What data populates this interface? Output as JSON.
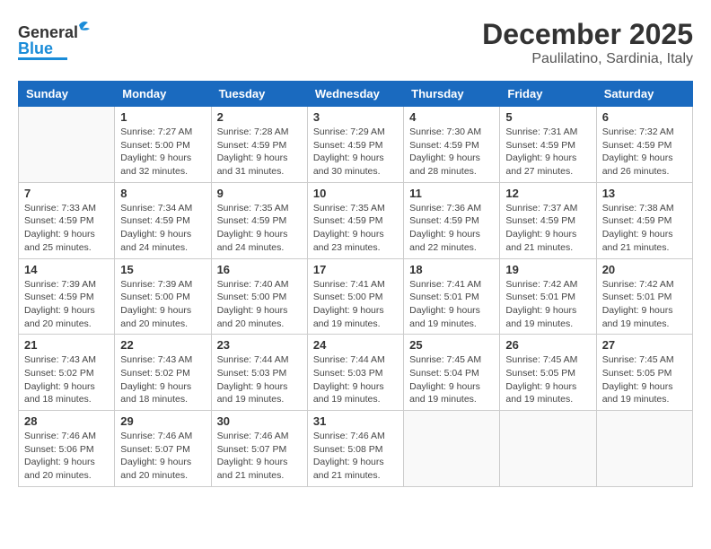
{
  "header": {
    "logo_general": "General",
    "logo_blue": "Blue",
    "month": "December 2025",
    "location": "Paulilatino, Sardinia, Italy"
  },
  "weekdays": [
    "Sunday",
    "Monday",
    "Tuesday",
    "Wednesday",
    "Thursday",
    "Friday",
    "Saturday"
  ],
  "weeks": [
    [
      {
        "day": "",
        "info": ""
      },
      {
        "day": "1",
        "info": "Sunrise: 7:27 AM\nSunset: 5:00 PM\nDaylight: 9 hours\nand 32 minutes."
      },
      {
        "day": "2",
        "info": "Sunrise: 7:28 AM\nSunset: 4:59 PM\nDaylight: 9 hours\nand 31 minutes."
      },
      {
        "day": "3",
        "info": "Sunrise: 7:29 AM\nSunset: 4:59 PM\nDaylight: 9 hours\nand 30 minutes."
      },
      {
        "day": "4",
        "info": "Sunrise: 7:30 AM\nSunset: 4:59 PM\nDaylight: 9 hours\nand 28 minutes."
      },
      {
        "day": "5",
        "info": "Sunrise: 7:31 AM\nSunset: 4:59 PM\nDaylight: 9 hours\nand 27 minutes."
      },
      {
        "day": "6",
        "info": "Sunrise: 7:32 AM\nSunset: 4:59 PM\nDaylight: 9 hours\nand 26 minutes."
      }
    ],
    [
      {
        "day": "7",
        "info": "Sunrise: 7:33 AM\nSunset: 4:59 PM\nDaylight: 9 hours\nand 25 minutes."
      },
      {
        "day": "8",
        "info": "Sunrise: 7:34 AM\nSunset: 4:59 PM\nDaylight: 9 hours\nand 24 minutes."
      },
      {
        "day": "9",
        "info": "Sunrise: 7:35 AM\nSunset: 4:59 PM\nDaylight: 9 hours\nand 24 minutes."
      },
      {
        "day": "10",
        "info": "Sunrise: 7:35 AM\nSunset: 4:59 PM\nDaylight: 9 hours\nand 23 minutes."
      },
      {
        "day": "11",
        "info": "Sunrise: 7:36 AM\nSunset: 4:59 PM\nDaylight: 9 hours\nand 22 minutes."
      },
      {
        "day": "12",
        "info": "Sunrise: 7:37 AM\nSunset: 4:59 PM\nDaylight: 9 hours\nand 21 minutes."
      },
      {
        "day": "13",
        "info": "Sunrise: 7:38 AM\nSunset: 4:59 PM\nDaylight: 9 hours\nand 21 minutes."
      }
    ],
    [
      {
        "day": "14",
        "info": "Sunrise: 7:39 AM\nSunset: 4:59 PM\nDaylight: 9 hours\nand 20 minutes."
      },
      {
        "day": "15",
        "info": "Sunrise: 7:39 AM\nSunset: 5:00 PM\nDaylight: 9 hours\nand 20 minutes."
      },
      {
        "day": "16",
        "info": "Sunrise: 7:40 AM\nSunset: 5:00 PM\nDaylight: 9 hours\nand 20 minutes."
      },
      {
        "day": "17",
        "info": "Sunrise: 7:41 AM\nSunset: 5:00 PM\nDaylight: 9 hours\nand 19 minutes."
      },
      {
        "day": "18",
        "info": "Sunrise: 7:41 AM\nSunset: 5:01 PM\nDaylight: 9 hours\nand 19 minutes."
      },
      {
        "day": "19",
        "info": "Sunrise: 7:42 AM\nSunset: 5:01 PM\nDaylight: 9 hours\nand 19 minutes."
      },
      {
        "day": "20",
        "info": "Sunrise: 7:42 AM\nSunset: 5:01 PM\nDaylight: 9 hours\nand 19 minutes."
      }
    ],
    [
      {
        "day": "21",
        "info": "Sunrise: 7:43 AM\nSunset: 5:02 PM\nDaylight: 9 hours\nand 18 minutes."
      },
      {
        "day": "22",
        "info": "Sunrise: 7:43 AM\nSunset: 5:02 PM\nDaylight: 9 hours\nand 18 minutes."
      },
      {
        "day": "23",
        "info": "Sunrise: 7:44 AM\nSunset: 5:03 PM\nDaylight: 9 hours\nand 19 minutes."
      },
      {
        "day": "24",
        "info": "Sunrise: 7:44 AM\nSunset: 5:03 PM\nDaylight: 9 hours\nand 19 minutes."
      },
      {
        "day": "25",
        "info": "Sunrise: 7:45 AM\nSunset: 5:04 PM\nDaylight: 9 hours\nand 19 minutes."
      },
      {
        "day": "26",
        "info": "Sunrise: 7:45 AM\nSunset: 5:05 PM\nDaylight: 9 hours\nand 19 minutes."
      },
      {
        "day": "27",
        "info": "Sunrise: 7:45 AM\nSunset: 5:05 PM\nDaylight: 9 hours\nand 19 minutes."
      }
    ],
    [
      {
        "day": "28",
        "info": "Sunrise: 7:46 AM\nSunset: 5:06 PM\nDaylight: 9 hours\nand 20 minutes."
      },
      {
        "day": "29",
        "info": "Sunrise: 7:46 AM\nSunset: 5:07 PM\nDaylight: 9 hours\nand 20 minutes."
      },
      {
        "day": "30",
        "info": "Sunrise: 7:46 AM\nSunset: 5:07 PM\nDaylight: 9 hours\nand 21 minutes."
      },
      {
        "day": "31",
        "info": "Sunrise: 7:46 AM\nSunset: 5:08 PM\nDaylight: 9 hours\nand 21 minutes."
      },
      {
        "day": "",
        "info": ""
      },
      {
        "day": "",
        "info": ""
      },
      {
        "day": "",
        "info": ""
      }
    ]
  ]
}
